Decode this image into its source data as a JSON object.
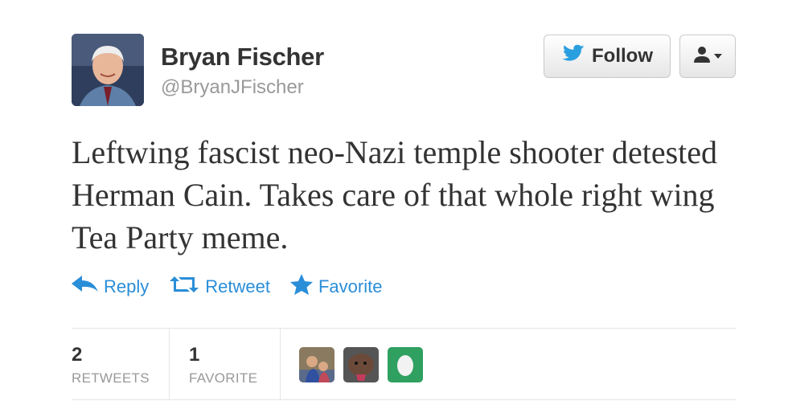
{
  "tweet": {
    "author_name": "Bryan Fischer",
    "author_handle": "@BryanJFischer",
    "text": "Leftwing fascist neo-Nazi temple shooter detested Herman Cain. Takes care of that whole right wing Tea Party meme."
  },
  "buttons": {
    "follow_label": "Follow",
    "follow_icon": "twitter-bird-icon",
    "user_menu_icon": "user-dropdown-icon"
  },
  "actions": [
    {
      "label": "Reply",
      "icon": "reply-icon"
    },
    {
      "label": "Retweet",
      "icon": "retweet-icon"
    },
    {
      "label": "Favorite",
      "icon": "star-icon"
    }
  ],
  "stats": {
    "retweets_count": "2",
    "retweets_label": "RETWEETS",
    "favorites_count": "1",
    "favorites_label": "FAVORITE"
  },
  "colors": {
    "link": "#2a8ed8",
    "text": "#333333",
    "muted": "#999999"
  }
}
